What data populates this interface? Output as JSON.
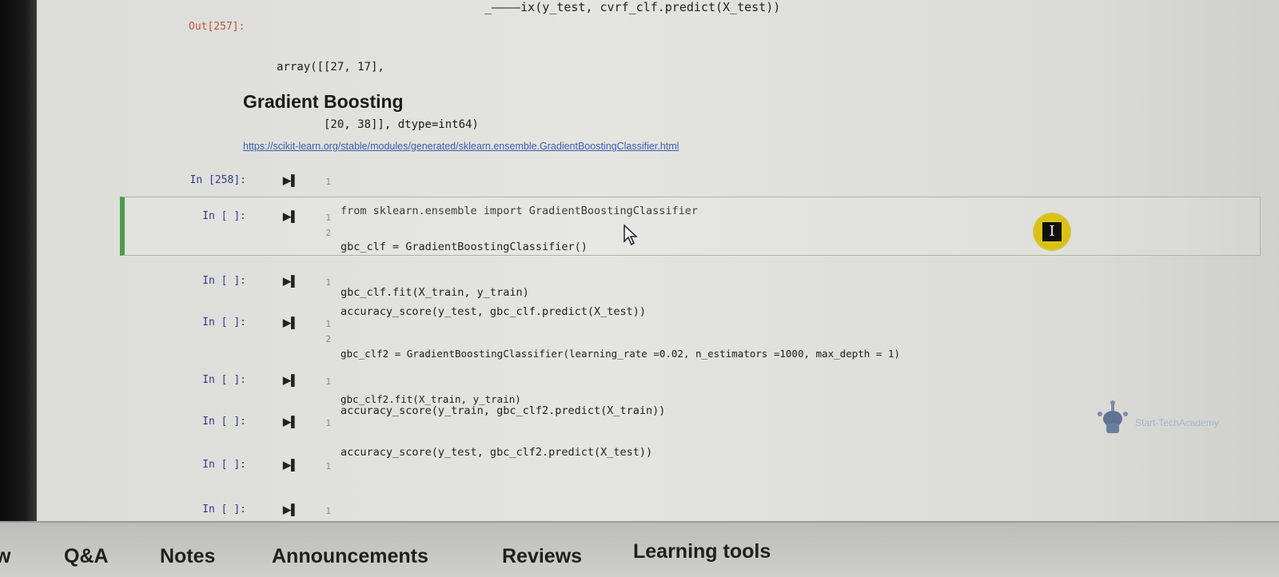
{
  "top_partial_code": "_————ix(y_test, cvrf_clf.predict(X_test))",
  "output": {
    "prompt": "Out[257]:",
    "lines": [
      "array([[27, 17],",
      "       [20, 38]], dtype=int64)"
    ]
  },
  "section": {
    "heading": "Gradient Boosting",
    "link": "https://scikit-learn.org/stable/modules/generated/sklearn.ensemble.GradientBoostingClassifier.html"
  },
  "run_icon_glyph": "▶▌",
  "cells": [
    {
      "prompt": "In [258]:",
      "lines": [
        "from sklearn.ensemble import GradientBoostingClassifier"
      ],
      "nums": [
        "1"
      ]
    },
    {
      "prompt": "In [ ]:",
      "lines": [
        "gbc_clf = GradientBoostingClassifier()",
        "gbc_clf.fit(X_train, y_train)"
      ],
      "nums": [
        "1",
        "2"
      ]
    },
    {
      "prompt": "In [ ]:",
      "lines": [
        "accuracy_score(y_test, gbc_clf.predict(X_test))"
      ],
      "nums": [
        "1"
      ]
    },
    {
      "prompt": "In [ ]:",
      "lines": [
        "gbc_clf2 = GradientBoostingClassifier(learning_rate =0.02, n_estimators =1000, max_depth = 1)",
        "gbc_clf2.fit(X_train, y_train)"
      ],
      "nums": [
        "1",
        "2"
      ]
    },
    {
      "prompt": "In [ ]:",
      "lines": [
        "accuracy_score(y_train, gbc_clf2.predict(X_train))"
      ],
      "nums": [
        "1"
      ]
    },
    {
      "prompt": "In [ ]:",
      "lines": [
        "accuracy_score(y_test, gbc_clf2.predict(X_test))"
      ],
      "nums": [
        "1"
      ]
    },
    {
      "prompt": "In [ ]:",
      "lines": [
        ""
      ],
      "nums": [
        "1"
      ]
    },
    {
      "prompt": "In [ ]:",
      "lines": [
        ""
      ],
      "nums": [
        "1"
      ]
    }
  ],
  "text_cursor_glyph": "I",
  "watermark": "Start-TechAcademy",
  "bottom_tabs": [
    "w",
    "Q&A",
    "Notes",
    "Announcements",
    "Reviews",
    "Learning tools"
  ],
  "colors": {
    "in_prompt": "#2f3b8a",
    "out_prompt": "#c0523e",
    "selected_cell_bar": "#4f9a4a",
    "link": "#3a5fb0",
    "cursor_highlight": "#e7cf1a"
  }
}
